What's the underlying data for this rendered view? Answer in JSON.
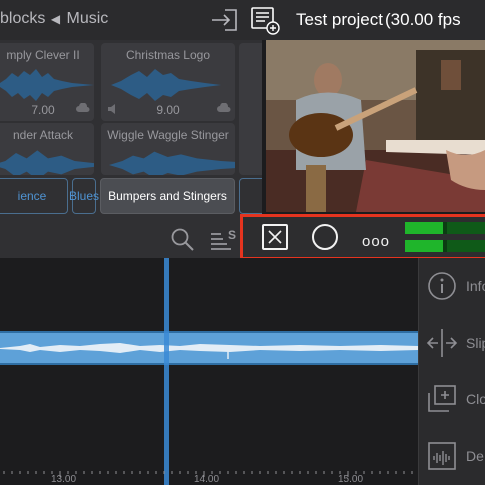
{
  "header": {
    "breadcrumb": [
      "blocks",
      "Music"
    ],
    "project_title": "Test project",
    "project_fps": "(30.00 fps"
  },
  "browser": {
    "tiles": [
      {
        "title": "mply Clever II",
        "duration": "7.00"
      },
      {
        "title": "Christmas Logo",
        "duration": "9.00"
      },
      {
        "title": "nder Attack",
        "duration": ""
      },
      {
        "title": "Wiggle Waggle Stinger",
        "duration": ""
      }
    ],
    "chips": [
      {
        "label": "ience",
        "selected": false
      },
      {
        "label": "Blues",
        "selected": false
      },
      {
        "label": "Bumpers and Stingers",
        "selected": true
      }
    ]
  },
  "toolbar": {
    "more_label": "ooo",
    "meter_levels": [
      0.48,
      0.48
    ]
  },
  "timeline": {
    "ruler_labels": [
      "13.00",
      "14.00",
      "15.00"
    ]
  },
  "inspector": {
    "items": [
      {
        "label": "Info",
        "icon": "info-icon"
      },
      {
        "label": "Slip",
        "icon": "slip-icon"
      },
      {
        "label": "Clo",
        "icon": "clone-icon"
      },
      {
        "label": "De",
        "icon": "detach-icon"
      }
    ]
  },
  "colors": {
    "accent": "#4f93d2",
    "highlight_border": "#e5341f",
    "clip": "#5ea1d8",
    "meter": "#1fb52b"
  }
}
